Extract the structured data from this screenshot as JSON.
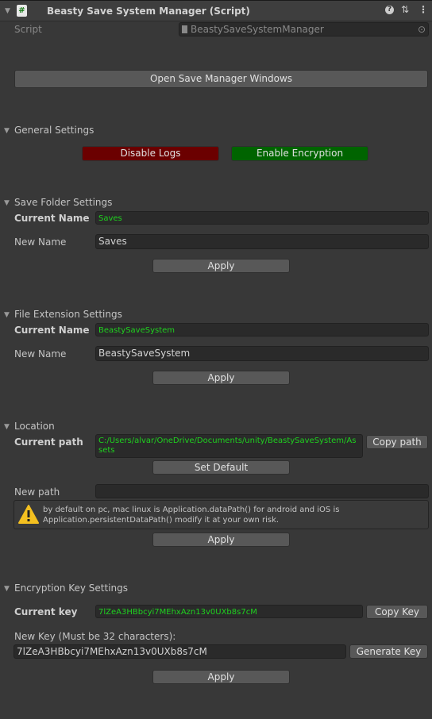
{
  "header": {
    "title": "Beasty Save System Manager (Script)",
    "icons": [
      "help-icon",
      "preset-icon",
      "menu-icon"
    ]
  },
  "script_row": {
    "label": "Script",
    "value": "BeastySaveSystemManager"
  },
  "open_button": "Open Save Manager Windows",
  "general": {
    "title": "General Settings",
    "disable_logs": "Disable Logs",
    "enable_encryption": "Enable Encryption",
    "colors": {
      "disable": "#6b0000",
      "enable": "#006400"
    }
  },
  "save_folder": {
    "title": "Save Folder Settings",
    "current_label": "Current Name",
    "current_value": "Saves",
    "new_label": "New Name",
    "new_value": "Saves",
    "apply": "Apply"
  },
  "file_ext": {
    "title": "File Extension Settings",
    "current_label": "Current Name",
    "current_value": "BeastySaveSystem",
    "new_label": "New Name",
    "new_value": "BeastySaveSystem",
    "apply": "Apply"
  },
  "location": {
    "title": "Location",
    "current_label": "Current path",
    "current_value": "C:/Users/alvar/OneDrive/Documents/unity/BeastySaveSystem/Assets",
    "copy": "Copy path",
    "set_default": "Set Default",
    "new_label": "New path",
    "new_value": "",
    "warning": "by default on pc, mac linux is Application.dataPath() for android and iOS is Application.persistentDataPath() modify it at your own risk.",
    "apply": "Apply"
  },
  "encryption": {
    "title": "Encryption Key Settings",
    "current_label": "Current key",
    "current_value": "7lZeA3HBbcyi7MEhxAzn13v0UXb8s7cM",
    "copy": "Copy Key",
    "new_label": "New Key (Must be 32 characters):",
    "new_value": "7lZeA3HBbcyi7MEhxAzn13v0UXb8s7cM",
    "generate": "Generate Key",
    "apply": "Apply"
  }
}
